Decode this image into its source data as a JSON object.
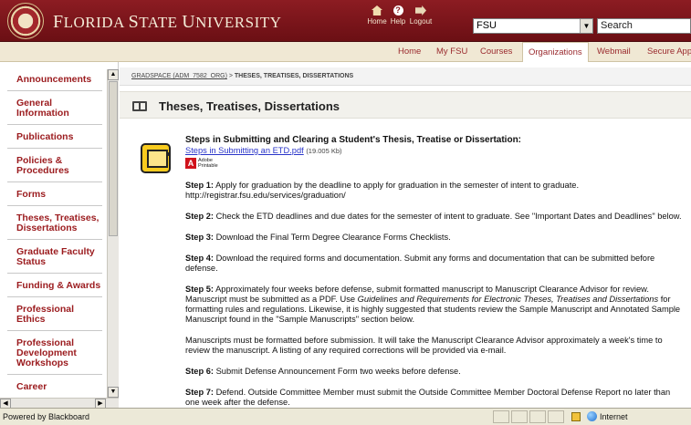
{
  "header": {
    "brand": "Florida State University",
    "brand_first": "F",
    "brand_rest_1": "LORIDA ",
    "brand_s": "S",
    "brand_rest_2": "TATE ",
    "brand_u": "U",
    "brand_rest_3": "NIVERSITY",
    "home_label": "Home",
    "help_label": "Help",
    "logout_label": "Logout",
    "dropdown_value": "FSU",
    "search_value": "Search"
  },
  "tabs": [
    {
      "label": "Home"
    },
    {
      "label": "My FSU"
    },
    {
      "label": "Courses"
    },
    {
      "label": "Organizations",
      "active": true
    },
    {
      "label": "Webmail"
    },
    {
      "label": "Secure Apps"
    }
  ],
  "sidebar": {
    "items": [
      {
        "label": "Announcements"
      },
      {
        "label": "General Information"
      },
      {
        "label": "Publications"
      },
      {
        "label": "Policies & Procedures"
      },
      {
        "label": "Forms"
      },
      {
        "label": "Theses, Treatises, Dissertations"
      },
      {
        "label": "Graduate Faculty Status"
      },
      {
        "label": "Funding & Awards"
      },
      {
        "label": "Professional Ethics"
      },
      {
        "label": "Professional Development Workshops"
      },
      {
        "label": "Career"
      }
    ]
  },
  "breadcrumb": {
    "link": "GRADSPACE (ADM_7582_ORG)",
    "separator": " > ",
    "current": "THESES, TREATISES, DISSERTATIONS"
  },
  "page": {
    "title": "Theses, Treatises, Dissertations"
  },
  "item": {
    "heading": "Steps in Submitting and Clearing a Student's Thesis, Treatise or Dissertation:",
    "file_link": "Steps in Submitting an ETD.pdf",
    "file_size": "(19.005 Kb)",
    "adobe_line1": "Adobe",
    "adobe_line2": "Printable",
    "step1_label": "Step 1:",
    "step1_text": "Apply for graduation by the deadline to apply for graduation  in the semester of intent to graduate.  http://registrar.fsu.edu/services/graduation/",
    "step2_label": "Step 2:",
    "step2_text": "Check the ETD deadlines and due dates for the semester of intent to graduate.  See \"Important Dates and Deadlines\" below.",
    "step3_label": "Step 3:",
    "step3_text": "Download the Final Term Degree Clearance Forms Checklists.",
    "step4_label": "Step 4:",
    "step4_text": "Download the required forms and documentation.  Submit any forms and documentation that can be submitted before defense.",
    "step5_label": "Step 5:",
    "step5_text_a": "Approximately four weeks before defense, submit formatted manuscript to Manuscript Clearance Advisor for review.  Manuscript must be submitted as a PDF.  Use ",
    "step5_guidelines": "Guidelines and Requirements for Electronic Theses, Treatises and Dissertations",
    "step5_text_b": " for formatting rules and regulations.  Likewise, it is highly suggested that students review the Sample Manuscript and Annotated Sample Manuscript found in the \"Sample Manuscripts\" section below.",
    "manuscripts_note": "Manuscripts must be formatted before submission.  It will take the Manuscript Clearance Advisor approximately a week's time to review the manuscript.  A listing of any required corrections will be provided via e-mail.",
    "step6_label": "Step 6:",
    "step6_text": "Submit Defense Announcement Form two weeks before defense.",
    "step7_label": "Step 7:",
    "step7_text": "Defend.  Outside Committee Member must submit the Outside Committee Member Doctoral Defense Report no later than one week after the defense."
  },
  "status": {
    "left_text": "Powered by Blackboard",
    "zone_text": "Internet"
  }
}
